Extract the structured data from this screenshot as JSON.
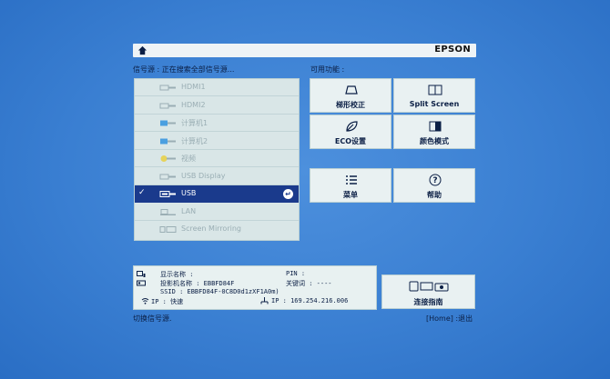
{
  "header": {
    "brand": "EPSON"
  },
  "source_header": "信号源 : 正在搜索全部信号源...",
  "features_header": "可用功能 :",
  "sources": [
    {
      "label": "HDMI1",
      "icon": "hdmi-icon"
    },
    {
      "label": "HDMI2",
      "icon": "hdmi-icon"
    },
    {
      "label": "计算机1",
      "icon": "vga-icon"
    },
    {
      "label": "计算机2",
      "icon": "vga-icon"
    },
    {
      "label": "视频",
      "icon": "video-icon"
    },
    {
      "label": "USB Display",
      "icon": "usb-display-icon"
    },
    {
      "label": "USB",
      "icon": "usb-icon",
      "selected": true
    },
    {
      "label": "LAN",
      "icon": "lan-icon"
    },
    {
      "label": "Screen Mirroring",
      "icon": "screen-mirroring-icon"
    }
  ],
  "features": [
    {
      "label": "梯形校正",
      "icon": "keystone-icon"
    },
    {
      "label": "Split Screen",
      "icon": "split-screen-icon"
    },
    {
      "label": "ECO设置",
      "icon": "eco-icon"
    },
    {
      "label": "颜色模式",
      "icon": "color-mode-icon"
    },
    {
      "label": "菜单",
      "icon": "menu-icon"
    },
    {
      "label": "帮助",
      "icon": "help-icon"
    }
  ],
  "info": {
    "display_name": "显示名称 :",
    "projector_name": "投影机名称 : EBBFD84F",
    "ssid": "SSID : EBBFD84F-0C8D0d1zXF1A0m)",
    "ip_left": "IP : 快速",
    "pin": "PIN :",
    "keyword": "关键词 : ----",
    "ip_right": "IP : 169.254.216.006"
  },
  "connection_guide": "连接指南",
  "footer": {
    "left": "切换信号源.",
    "right": "[Home] :退出"
  },
  "colors": {
    "accent": "#1a3a8c",
    "background": "#3a7fd2"
  }
}
